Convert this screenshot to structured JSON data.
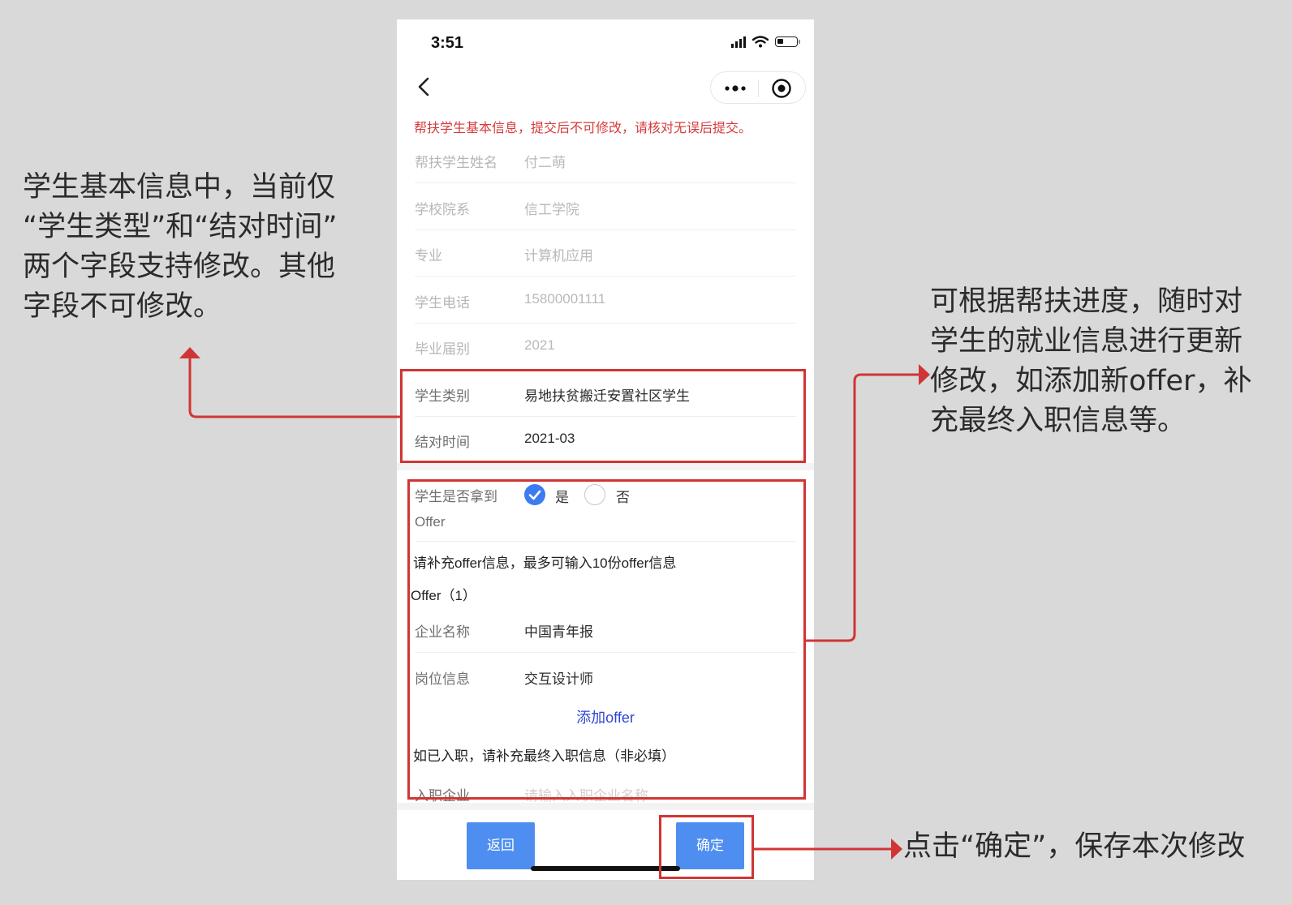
{
  "annotations": {
    "left": "学生基本信息中，当前仅\n“学生类型”和“结对时间”\n两个字段支持修改。其他\n字段不可修改。",
    "right": "可根据帮扶进度，随时对\n学生的就业信息进行更新\n修改，如添加新offer，补\n充最终入职信息等。",
    "bottom": "点击“确定”，保存本次修改"
  },
  "status_bar": {
    "time": "3:51"
  },
  "nav": {
    "back_icon": "chevron-left-icon",
    "more_icon": "more-dots-icon",
    "close_icon": "target-circle-icon"
  },
  "warning": "帮扶学生基本信息，提交后不可修改，请核对无误后提交。",
  "basic_info": [
    {
      "label": "帮扶学生姓名",
      "value": "付二萌",
      "editable": false
    },
    {
      "label": "学校院系",
      "value": "信工学院",
      "editable": false
    },
    {
      "label": "专业",
      "value": "计算机应用",
      "editable": false
    },
    {
      "label": "学生电话",
      "value": "15800001111",
      "editable": false
    },
    {
      "label": "毕业届别",
      "value": "2021",
      "editable": false
    },
    {
      "label": "学生类别",
      "value": "易地扶贫搬迁安置社区学生",
      "editable": true
    },
    {
      "label": "结对时间",
      "value": "2021-03",
      "editable": true
    }
  ],
  "offer_section": {
    "question": "学生是否拿到\nOffer",
    "options": [
      {
        "label": "是",
        "checked": true
      },
      {
        "label": "否",
        "checked": false
      }
    ],
    "hint": "请补充offer信息，最多可输入10份offer信息",
    "offer_heading": "Offer（1）",
    "company_label": "企业名称",
    "company_value": "中国青年报",
    "position_label": "岗位信息",
    "position_value": "交互设计师",
    "add_offer": "添加offer",
    "onboard_hint": "如已入职，请补充最终入职信息（非必填）",
    "join_label": "入职企业",
    "join_placeholder": "请输入入职企业名称"
  },
  "buttons": {
    "back": "返回",
    "confirm": "确定"
  },
  "colors": {
    "highlight": "#d03535",
    "primary_button": "#4e8ef0",
    "warning_text": "#d63b3b",
    "link": "#2f46d6",
    "radio_checked": "#3d7cf0"
  }
}
